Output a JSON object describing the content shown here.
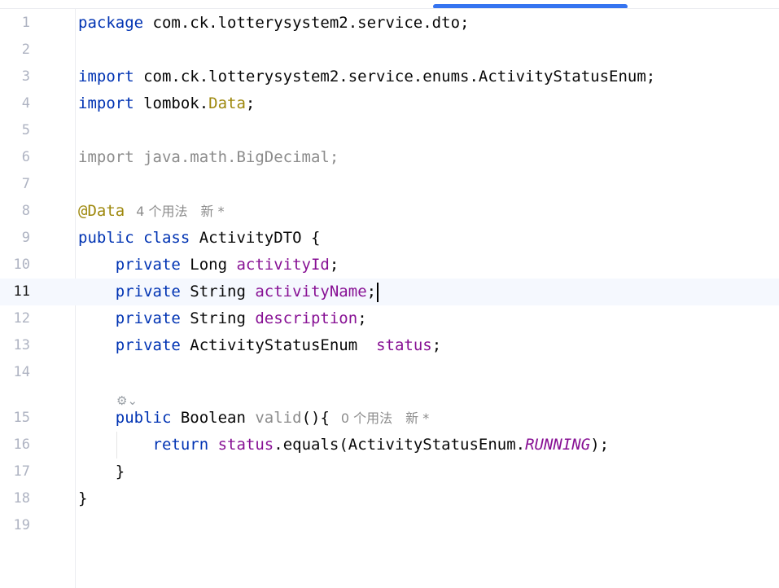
{
  "lines": [
    {
      "num": "1",
      "tokens": [
        {
          "t": "package",
          "c": "kw"
        },
        {
          "t": " com.ck.lotterysystem2.service.dto;",
          "c": ""
        }
      ]
    },
    {
      "num": "2",
      "tokens": []
    },
    {
      "num": "3",
      "tokens": [
        {
          "t": "import",
          "c": "kw"
        },
        {
          "t": " com.ck.lotterysystem2.service.enums.ActivityStatusEnum;",
          "c": ""
        }
      ]
    },
    {
      "num": "4",
      "tokens": [
        {
          "t": "import",
          "c": "kw"
        },
        {
          "t": " lombok.",
          "c": ""
        },
        {
          "t": "Data",
          "c": "ann"
        },
        {
          "t": ";",
          "c": ""
        }
      ]
    },
    {
      "num": "5",
      "tokens": []
    },
    {
      "num": "6",
      "tokens": [
        {
          "t": "import java.math.BigDecimal;",
          "c": "unused"
        }
      ]
    },
    {
      "num": "7",
      "tokens": []
    },
    {
      "num": "8",
      "tokens": [
        {
          "t": "@Data",
          "c": "ann"
        }
      ],
      "hints": [
        "4 个用法",
        "新 *"
      ]
    },
    {
      "num": "9",
      "tokens": [
        {
          "t": "public class",
          "c": "kw"
        },
        {
          "t": " ActivityDTO {",
          "c": ""
        }
      ]
    },
    {
      "num": "10",
      "tokens": [
        {
          "t": "    ",
          "c": ""
        },
        {
          "t": "private",
          "c": "kw"
        },
        {
          "t": " Long ",
          "c": ""
        },
        {
          "t": "activityId",
          "c": "fld"
        },
        {
          "t": ";",
          "c": ""
        }
      ]
    },
    {
      "num": "11",
      "current": true,
      "caret": true,
      "tokens": [
        {
          "t": "    ",
          "c": ""
        },
        {
          "t": "private",
          "c": "kw"
        },
        {
          "t": " String ",
          "c": ""
        },
        {
          "t": "activityName",
          "c": "fld"
        },
        {
          "t": ";",
          "c": ""
        }
      ]
    },
    {
      "num": "12",
      "tokens": [
        {
          "t": "    ",
          "c": ""
        },
        {
          "t": "private",
          "c": "kw"
        },
        {
          "t": " String ",
          "c": ""
        },
        {
          "t": "description",
          "c": "fld"
        },
        {
          "t": ";",
          "c": ""
        }
      ]
    },
    {
      "num": "13",
      "tokens": [
        {
          "t": "    ",
          "c": ""
        },
        {
          "t": "private",
          "c": "kw"
        },
        {
          "t": " ActivityStatusEnum  ",
          "c": ""
        },
        {
          "t": "status",
          "c": "fld"
        },
        {
          "t": ";",
          "c": ""
        }
      ]
    },
    {
      "num": "14",
      "tokens": []
    },
    {
      "num": "15",
      "inlay": true,
      "tokens": [
        {
          "t": "    ",
          "c": ""
        },
        {
          "t": "public",
          "c": "kw"
        },
        {
          "t": " Boolean ",
          "c": ""
        },
        {
          "t": "valid",
          "c": "method-unused"
        },
        {
          "t": "(){",
          "c": ""
        }
      ],
      "hints": [
        "0 个用法",
        "新 *"
      ]
    },
    {
      "num": "16",
      "guide": true,
      "tokens": [
        {
          "t": "        ",
          "c": ""
        },
        {
          "t": "return",
          "c": "kw"
        },
        {
          "t": " ",
          "c": ""
        },
        {
          "t": "status",
          "c": "fld"
        },
        {
          "t": ".equals(ActivityStatusEnum.",
          "c": ""
        },
        {
          "t": "RUNNING",
          "c": "fld-static"
        },
        {
          "t": ");",
          "c": ""
        }
      ]
    },
    {
      "num": "17",
      "tokens": [
        {
          "t": "    }",
          "c": ""
        }
      ]
    },
    {
      "num": "18",
      "tokens": [
        {
          "t": "}",
          "c": ""
        }
      ]
    },
    {
      "num": "19",
      "tokens": []
    }
  ],
  "gutter_icon": {
    "name": "code-vision-icon",
    "glyph": "⚙⌄"
  }
}
